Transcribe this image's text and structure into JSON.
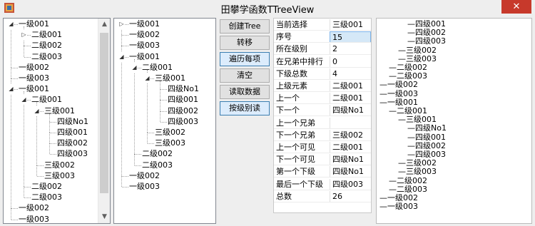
{
  "window": {
    "title": "田攀学函数TTreeView",
    "close_label": "✕",
    "app_icon": "app-icon"
  },
  "tree1": {
    "nodes": [
      {
        "label": "一级001",
        "level": 0,
        "toggle": "expanded"
      },
      {
        "label": "二级001",
        "level": 1,
        "toggle": "collapsed"
      },
      {
        "label": "二级002",
        "level": 1
      },
      {
        "label": "二级003",
        "level": 1
      },
      {
        "label": "一级002",
        "level": 0
      },
      {
        "label": "一级003",
        "level": 0
      },
      {
        "label": "一级001",
        "level": 0,
        "toggle": "expanded"
      },
      {
        "label": "二级001",
        "level": 1,
        "toggle": "expanded"
      },
      {
        "label": "三级001",
        "level": 2,
        "toggle": "expanded"
      },
      {
        "label": "四级No1",
        "level": 3
      },
      {
        "label": "四级001",
        "level": 3
      },
      {
        "label": "四级002",
        "level": 3
      },
      {
        "label": "四级003",
        "level": 3
      },
      {
        "label": "三级002",
        "level": 2
      },
      {
        "label": "三级003",
        "level": 2
      },
      {
        "label": "二级002",
        "level": 1
      },
      {
        "label": "二级003",
        "level": 1
      },
      {
        "label": "一级002",
        "level": 0
      },
      {
        "label": "一级003",
        "level": 0
      }
    ]
  },
  "tree2": {
    "nodes": [
      {
        "label": "一级001",
        "level": 0,
        "toggle": "collapsed"
      },
      {
        "label": "一级002",
        "level": 0
      },
      {
        "label": "一级003",
        "level": 0
      },
      {
        "label": "一级001",
        "level": 0,
        "toggle": "expanded"
      },
      {
        "label": "二级001",
        "level": 1,
        "toggle": "expanded"
      },
      {
        "label": "三级001",
        "level": 2,
        "toggle": "expanded"
      },
      {
        "label": "四级No1",
        "level": 3
      },
      {
        "label": "四级001",
        "level": 3
      },
      {
        "label": "四级002",
        "level": 3
      },
      {
        "label": "四级003",
        "level": 3
      },
      {
        "label": "三级002",
        "level": 2
      },
      {
        "label": "三级003",
        "level": 2
      },
      {
        "label": "二级002",
        "level": 1
      },
      {
        "label": "二级003",
        "level": 1
      },
      {
        "label": "一级002",
        "level": 0
      },
      {
        "label": "一级003",
        "level": 0
      }
    ]
  },
  "tree3": {
    "lines": [
      {
        "text": "四级001",
        "level": 3
      },
      {
        "text": "四级002",
        "level": 3
      },
      {
        "text": "四级003",
        "level": 3
      },
      {
        "text": "三级002",
        "level": 2
      },
      {
        "text": "三级003",
        "level": 2
      },
      {
        "text": "二级002",
        "level": 1
      },
      {
        "text": "二级003",
        "level": 1
      },
      {
        "text": "一级002",
        "level": 0
      },
      {
        "text": "一级003",
        "level": 0
      },
      {
        "text": "一级001",
        "level": 0
      },
      {
        "text": "二级001",
        "level": 1
      },
      {
        "text": "三级001",
        "level": 2
      },
      {
        "text": "四级No1",
        "level": 3
      },
      {
        "text": "四级001",
        "level": 3
      },
      {
        "text": "四级002",
        "level": 3
      },
      {
        "text": "四级003",
        "level": 3
      },
      {
        "text": "三级002",
        "level": 2
      },
      {
        "text": "三级003",
        "level": 2
      },
      {
        "text": "二级002",
        "level": 1
      },
      {
        "text": "二级003",
        "level": 1
      },
      {
        "text": "一级002",
        "level": 0
      },
      {
        "text": "一级003",
        "level": 0
      }
    ]
  },
  "buttons": [
    {
      "label": "创建Tree",
      "selected": false
    },
    {
      "label": "转移",
      "selected": false
    },
    {
      "label": "遍历每项",
      "selected": true
    },
    {
      "label": "清空",
      "selected": false
    },
    {
      "label": "读取数据",
      "selected": false
    },
    {
      "label": "按级别读",
      "selected": true
    }
  ],
  "info": {
    "rows": [
      {
        "key": "当前选择",
        "value": "三级001"
      },
      {
        "key": "序号",
        "value": "15",
        "focused": true
      },
      {
        "key": "所在级别",
        "value": "2"
      },
      {
        "key": "在兄弟中排行",
        "value": "0"
      },
      {
        "key": "下级总数",
        "value": "4"
      },
      {
        "key": "上级元素",
        "value": "二级001"
      },
      {
        "key": "上一个",
        "value": "二级001"
      },
      {
        "key": "下一个",
        "value": "四级No1"
      },
      {
        "key": "上一个兄弟",
        "value": ""
      },
      {
        "key": "下一个兄弟",
        "value": "三级002"
      },
      {
        "key": "上一个可见",
        "value": "二级001"
      },
      {
        "key": "下一个可见",
        "value": "四级No1"
      },
      {
        "key": "第一个下级",
        "value": "四级No1"
      },
      {
        "key": "最后一个下级",
        "value": "四级003"
      },
      {
        "key": "总数",
        "value": "26"
      }
    ]
  },
  "icons": {
    "expanded": "expanded-triangle-icon",
    "collapsed": "collapsed-triangle-icon",
    "scroll_up": "scroll-up-arrow-icon",
    "scroll_down": "scroll-down-arrow-icon"
  },
  "colors": {
    "focus_bg": "#d5e8f7",
    "selected_btn": "#dcecfc",
    "close_bg": "#c7392b"
  }
}
